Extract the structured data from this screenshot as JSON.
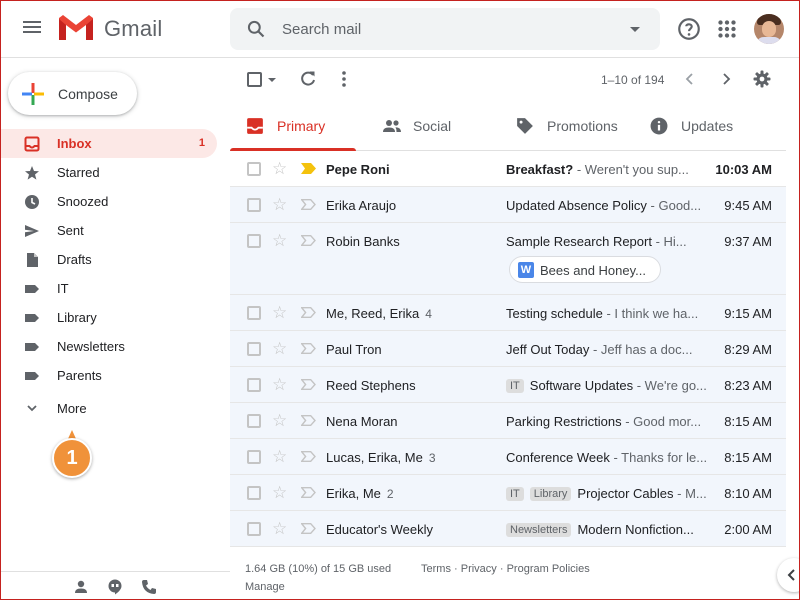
{
  "app": {
    "name": "Gmail"
  },
  "search": {
    "placeholder": "Search mail"
  },
  "compose": {
    "label": "Compose"
  },
  "sidebar": {
    "items": [
      {
        "label": "Inbox",
        "count": "1",
        "icon": "inbox-icon"
      },
      {
        "label": "Starred",
        "count": "",
        "icon": "star-icon"
      },
      {
        "label": "Snoozed",
        "count": "",
        "icon": "clock-icon"
      },
      {
        "label": "Sent",
        "count": "",
        "icon": "send-icon"
      },
      {
        "label": "Drafts",
        "count": "",
        "icon": "draft-icon"
      },
      {
        "label": "IT",
        "count": "",
        "icon": "label-icon"
      },
      {
        "label": "Library",
        "count": "",
        "icon": "label-icon"
      },
      {
        "label": "Newsletters",
        "count": "",
        "icon": "label-icon"
      },
      {
        "label": "Parents",
        "count": "",
        "icon": "label-icon"
      }
    ],
    "more_label": "More"
  },
  "callout": {
    "number": "1"
  },
  "toolbar": {
    "page_info": "1–10 of 194"
  },
  "tabs": [
    {
      "label": "Primary",
      "icon": "inbox-icon"
    },
    {
      "label": "Social",
      "icon": "people-icon"
    },
    {
      "label": "Promotions",
      "icon": "tag-icon"
    },
    {
      "label": "Updates",
      "icon": "info-icon"
    }
  ],
  "emails": [
    {
      "sender": "Pepe Roni",
      "count": "",
      "labels": [],
      "subject": "Breakfast?",
      "snippet": " - Weren't you sup...",
      "time": "10:03 AM",
      "unread": true,
      "important": true
    },
    {
      "sender": "Erika Araujo",
      "count": "",
      "labels": [],
      "subject": "Updated Absence Policy",
      "snippet": " - Good...",
      "time": "9:45 AM",
      "unread": false,
      "important": false
    },
    {
      "sender": "Robin Banks",
      "count": "",
      "labels": [],
      "subject": "Sample Research Report",
      "snippet": " - Hi...",
      "time": "9:37 AM",
      "unread": false,
      "important": false,
      "attachment": "Bees and Honey..."
    },
    {
      "sender": "Me, Reed, Erika",
      "count": "4",
      "labels": [],
      "subject": "Testing schedule",
      "snippet": " - I think we ha...",
      "time": "9:15 AM",
      "unread": false,
      "important": false
    },
    {
      "sender": "Paul Tron",
      "count": "",
      "labels": [],
      "subject": "Jeff Out Today ",
      "snippet": " - Jeff has a doc...",
      "time": "8:29 AM",
      "unread": false,
      "important": false
    },
    {
      "sender": "Reed Stephens",
      "count": "",
      "labels": [
        "IT"
      ],
      "subject": "Software Updates",
      "snippet": " - We're go...",
      "time": "8:23 AM",
      "unread": false,
      "important": false
    },
    {
      "sender": "Nena Moran",
      "count": "",
      "labels": [],
      "subject": "Parking Restrictions",
      "snippet": " - Good mor...",
      "time": "8:15 AM",
      "unread": false,
      "important": false
    },
    {
      "sender": "Lucas, Erika, Me",
      "count": "3",
      "labels": [],
      "subject": "Conference Week",
      "snippet": " - Thanks for le...",
      "time": "8:15 AM",
      "unread": false,
      "important": false
    },
    {
      "sender": "Erika, Me",
      "count": "2",
      "labels": [
        "IT",
        "Library"
      ],
      "subject": "Projector Cables",
      "snippet": " - M...",
      "time": "8:10 AM",
      "unread": false,
      "important": false
    },
    {
      "sender": "Educator's Weekly",
      "count": "",
      "labels": [
        "Newsletters"
      ],
      "subject": "Modern Nonfiction...",
      "snippet": "",
      "time": "2:00 AM",
      "unread": false,
      "important": false
    }
  ],
  "footer": {
    "storage": "1.64 GB (10%) of 15 GB used",
    "manage": "Manage",
    "terms": "Terms",
    "privacy": "Privacy",
    "policies": "Program Policies",
    "sep": " · "
  },
  "colors": {
    "accent": "#d93025",
    "active_bg": "#fce8e6",
    "read_bg": "#f2f6fc",
    "callout": "#f0923a"
  }
}
